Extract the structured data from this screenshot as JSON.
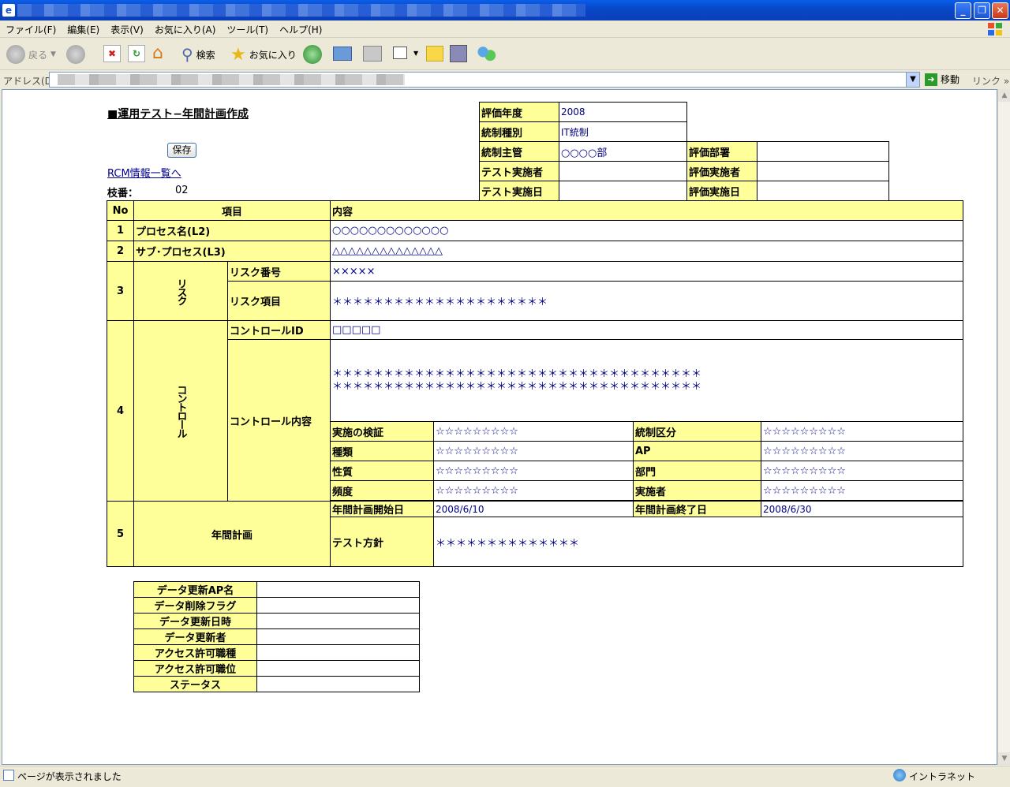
{
  "menu": [
    "ファイル(F)",
    "編集(E)",
    "表示(V)",
    "お気に入り(A)",
    "ツール(T)",
    "ヘルプ(H)"
  ],
  "toolbar": {
    "back": "戻る",
    "search": "検索",
    "favorites": "お気に入り"
  },
  "address": {
    "label": "アドレス(D)",
    "go": "移動",
    "links": "リンク"
  },
  "status": {
    "text": "ページが表示されました",
    "zone": "イントラネット"
  },
  "page": {
    "heading": "■運用テスト−年間計画作成",
    "save": "保存",
    "rcm_link": "RCM情報一覧へ",
    "branch_label": "枝番：",
    "branch_value": "02"
  },
  "info": {
    "eval_year_label": "評価年度",
    "eval_year": "2008",
    "control_type_label": "統制種別",
    "control_type": "IT統制",
    "control_owner_label": "統制主管",
    "control_owner": "○○○○部",
    "eval_dept_label": "評価部署",
    "eval_dept": "",
    "tester_label": "テスト実施者",
    "tester": "",
    "evaluator_label": "評価実施者",
    "evaluator": "",
    "test_date_label": "テスト実施日",
    "test_date": "",
    "eval_date_label": "評価実施日",
    "eval_date": ""
  },
  "main": {
    "head_no": "No",
    "head_item": "項目",
    "head_content": "内容",
    "r1_no": "1",
    "r1_item": "プロセス名(L2)",
    "r1_val": "○○○○○○○○○○○○○",
    "r2_no": "2",
    "r2_item": "サブ･プロセス(L3)",
    "r2_val": "△△△△△△△△△△△△△△",
    "r3_no": "3",
    "r3_group": "リスク",
    "r3a_item": "リスク番号",
    "r3a_val": "×××××",
    "r3b_item": "リスク項目",
    "r3b_val": "＊＊＊＊＊＊＊＊＊＊＊＊＊＊＊＊＊＊＊＊＊",
    "r4_no": "4",
    "r4_group": "コントロール",
    "r4a_item": "コントロールID",
    "r4a_val": "□□□□□",
    "r4b_item": "コントロール内容",
    "r4b_val1": "＊＊＊＊＊＊＊＊＊＊＊＊＊＊＊＊＊＊＊＊＊＊＊＊＊＊＊＊＊＊＊＊＊＊＊＊",
    "r4b_val2": "＊＊＊＊＊＊＊＊＊＊＊＊＊＊＊＊＊＊＊＊＊＊＊＊＊＊＊＊＊＊＊＊＊＊＊＊",
    "d1_label": "実施の検証",
    "d1_val": "☆☆☆☆☆☆☆☆☆",
    "d2_label": "統制区分",
    "d2_val": "☆☆☆☆☆☆☆☆☆",
    "d3_label": "種類",
    "d3_val": "☆☆☆☆☆☆☆☆☆",
    "d4_label": "AP",
    "d4_val": "☆☆☆☆☆☆☆☆☆",
    "d5_label": "性質",
    "d5_val": "☆☆☆☆☆☆☆☆☆",
    "d6_label": "部門",
    "d6_val": "☆☆☆☆☆☆☆☆☆",
    "d7_label": "頻度",
    "d7_val": "☆☆☆☆☆☆☆☆☆",
    "d8_label": "実施者",
    "d8_val": "☆☆☆☆☆☆☆☆☆",
    "r5_no": "5",
    "r5_item": "年間計画",
    "p1_label": "年間計画開始日",
    "p1_val": "2008/6/10",
    "p2_label": "年間計画終了日",
    "p2_val": "2008/6/30",
    "p3_label": "テスト方針",
    "p3_val": "＊＊＊＊＊＊＊＊＊＊＊＊＊＊"
  },
  "meta": {
    "m1": "データ更新AP名",
    "m2": "データ削除フラグ",
    "m3": "データ更新日時",
    "m4": "データ更新者",
    "m5": "アクセス許可職種",
    "m6": "アクセス許可職位",
    "m7": "ステータス"
  }
}
